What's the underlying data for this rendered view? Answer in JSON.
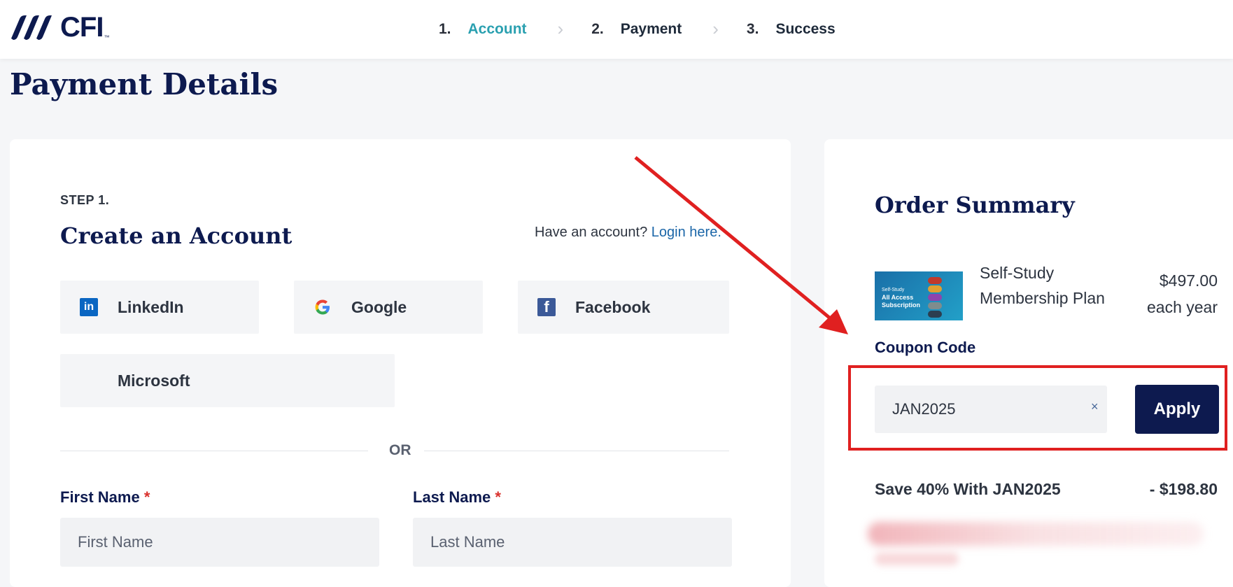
{
  "header": {
    "logo_text": "CFI",
    "logo_tm": "™",
    "steps": [
      {
        "num": "1.",
        "label": "Account"
      },
      {
        "num": "2.",
        "label": "Payment"
      },
      {
        "num": "3.",
        "label": "Success"
      }
    ],
    "active_step": "Account",
    "accent_color": "#2aa0b0"
  },
  "page": {
    "title": "Payment Details"
  },
  "account": {
    "step_label": "STEP 1.",
    "heading": "Create an Account",
    "have_account_text": "Have an account?",
    "login_link": "Login here.",
    "social": {
      "linkedin": "LinkedIn",
      "google": "Google",
      "facebook": "Facebook",
      "microsoft": "Microsoft"
    },
    "or_text": "OR",
    "first_name": {
      "label": "First Name",
      "required_mark": "*",
      "placeholder": "First Name"
    },
    "last_name": {
      "label": "Last Name",
      "required_mark": "*",
      "placeholder": "Last Name"
    }
  },
  "order_summary": {
    "title": "Order Summary",
    "product": {
      "image_caption_line1": "Self-Study",
      "image_caption_line2": "All Access",
      "image_caption_line3": "Subscription",
      "name": "Self-Study Membership Plan",
      "price": "$497.00",
      "period": "each year"
    },
    "coupon": {
      "label": "Coupon Code",
      "value": "JAN2025",
      "clear_icon": "×",
      "apply_label": "Apply"
    },
    "discount": {
      "label": "Save 40% With JAN2025",
      "amount": "- $198.80"
    }
  },
  "colors": {
    "navy": "#0d1a4f",
    "annotation_red": "#e02020",
    "link": "#1b66a8"
  }
}
